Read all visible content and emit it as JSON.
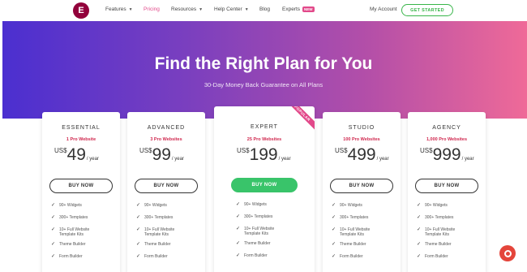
{
  "nav": {
    "logo_text": "E",
    "items": [
      {
        "label": "Features",
        "caret": true,
        "active": false
      },
      {
        "label": "Pricing",
        "caret": false,
        "active": true
      },
      {
        "label": "Resources",
        "caret": true,
        "active": false
      },
      {
        "label": "Help Center",
        "caret": true,
        "active": false
      },
      {
        "label": "Blog",
        "caret": false,
        "active": false
      },
      {
        "label": "Experts",
        "caret": false,
        "active": false
      }
    ],
    "experts_badge": "NEW",
    "account": "My Account",
    "cta": "GET STARTED"
  },
  "hero": {
    "title": "Find the Right Plan for You",
    "subtitle": "30-Day Money Back Guarantee on All Plans"
  },
  "plans": [
    {
      "name": "ESSENTIAL",
      "sites": "1 Pro Website",
      "currency": "US$",
      "amount": "49",
      "per": "/ year",
      "cta": "BUY NOW"
    },
    {
      "name": "ADVANCED",
      "sites": "3 Pro Websites",
      "currency": "US$",
      "amount": "99",
      "per": "/ year",
      "cta": "BUY NOW"
    },
    {
      "name": "EXPERT",
      "sites": "25 Pro Websites",
      "currency": "US$",
      "amount": "199",
      "per": "/ year",
      "cta": "BUY NOW",
      "ribbon": "POPULAR"
    },
    {
      "name": "STUDIO",
      "sites": "100 Pro Websites",
      "currency": "US$",
      "amount": "499",
      "per": "/ year",
      "cta": "BUY NOW"
    },
    {
      "name": "AGENCY",
      "sites": "1,000 Pro Websites",
      "currency": "US$",
      "amount": "999",
      "per": "/ year",
      "cta": "BUY NOW"
    }
  ],
  "features": [
    "90+ Widgets",
    "300+ Templates",
    "10+ Full Website Template Kits",
    "Theme Builder",
    "Form Builder"
  ],
  "colors": {
    "accent": "#e2498a",
    "green": "#39c46a",
    "price_red": "#d0284f",
    "chat": "#e4453b"
  },
  "chat_icon": "chat-bubble-icon"
}
